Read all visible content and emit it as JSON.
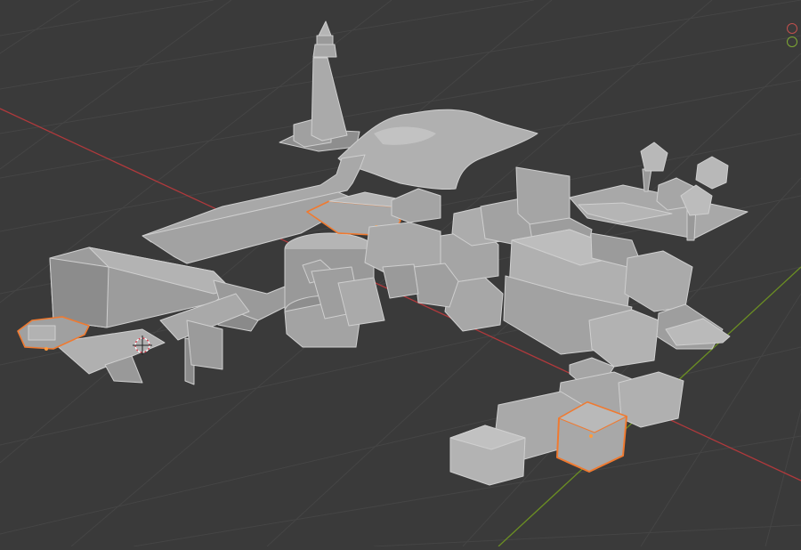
{
  "viewport": {
    "view": "3d-viewport",
    "shading": "solid",
    "background_color": "#3a3a3a",
    "grid_color": "#454545",
    "x_axis_color": "#b0393c",
    "y_axis_color": "#6b8e23",
    "object_color": "#a6a6a6",
    "selection_outline_color": "#f07a30",
    "active_selection_color": "#ff9a3c"
  },
  "scene": {
    "objects": [
      "lighthouse",
      "rock-terrain",
      "road",
      "platform",
      "tree-pad",
      "buildings",
      "boat",
      "selected-box"
    ],
    "selected_objects": [
      "boat",
      "wall-block",
      "selected-box"
    ]
  },
  "overlays": {
    "gizmo_icons": [
      "red-circle-icon",
      "green-circle-icon"
    ],
    "cursor": "3d-cursor-icon"
  }
}
